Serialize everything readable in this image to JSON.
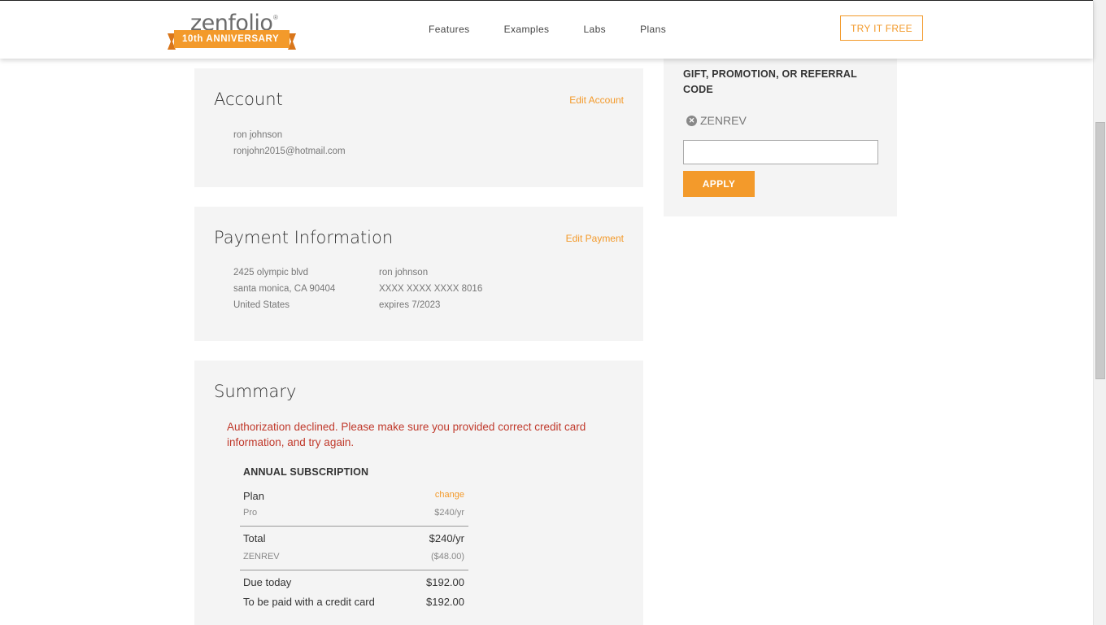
{
  "header": {
    "logo_text": "zenfolio",
    "logo_badge": "10th ANNIVERSARY",
    "nav": [
      "Features",
      "Examples",
      "Labs",
      "Plans"
    ],
    "try_free_label": "TRY IT FREE"
  },
  "account": {
    "title": "Account",
    "edit_label": "Edit Account",
    "name": "ron johnson",
    "email": "ronjohn2015@hotmail.com"
  },
  "payment": {
    "title": "Payment Information",
    "edit_label": "Edit Payment",
    "address_line1": "2425 olympic blvd",
    "address_line2": "santa monica, CA 90404",
    "country": "United States",
    "cardholder": "ron johnson",
    "card_number": "XXXX XXXX XXXX 8016",
    "expires": "expires 7/2023"
  },
  "summary": {
    "title": "Summary",
    "error": "Authorization declined. Please make sure you provided correct credit card information, and try again.",
    "subscription_heading": "ANNUAL SUBSCRIPTION",
    "plan_label": "Plan",
    "change_label": "change",
    "plan_name": "Pro",
    "plan_price": "$240/yr",
    "total_label": "Total",
    "total_value": "$240/yr",
    "discount_code": "ZENREV",
    "discount_value": "($48.00)",
    "due_today_label": "Due today",
    "due_today_value": "$192.00",
    "credit_card_label": "To be paid with a credit card",
    "credit_card_value": "$192.00"
  },
  "promo": {
    "title": "GIFT, PROMOTION, OR REFERRAL CODE",
    "applied_code": "ZENREV",
    "input_value": "",
    "apply_label": "APPLY"
  },
  "colors": {
    "accent": "#f39a2b",
    "error": "#c0392b",
    "panel_bg": "#f4f4f4"
  }
}
